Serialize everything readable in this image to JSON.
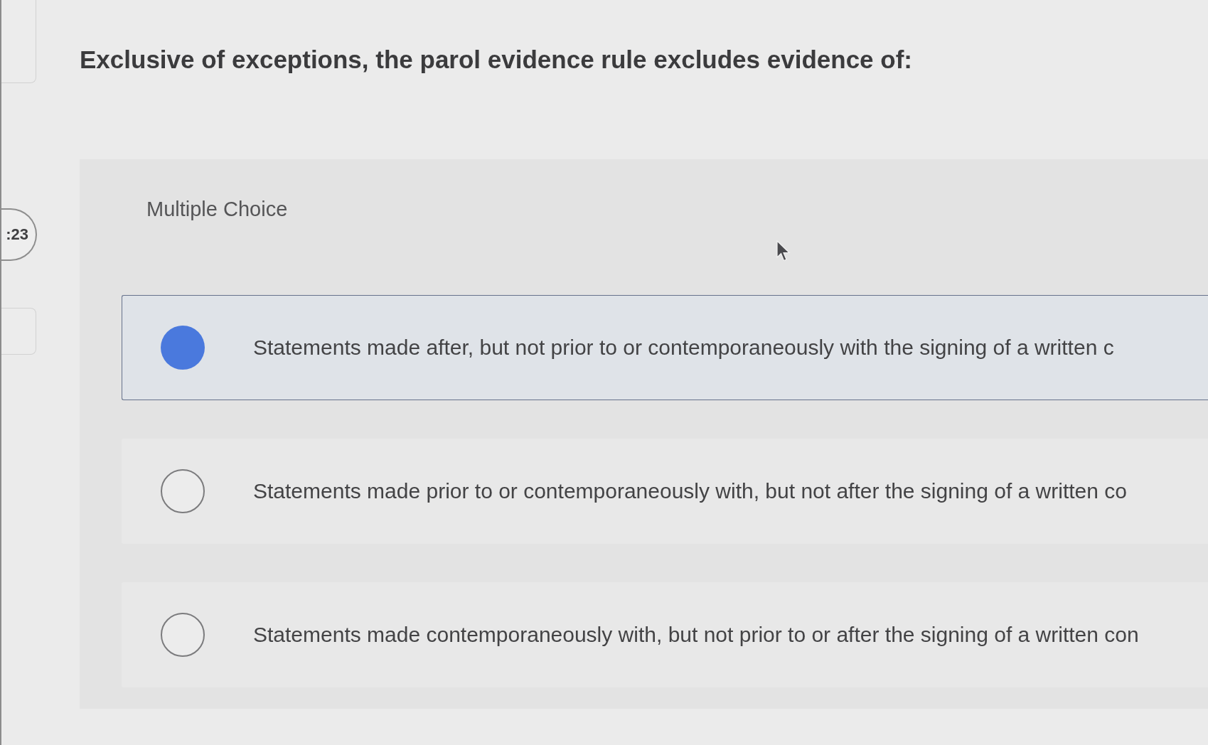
{
  "timer": {
    "text": ":23"
  },
  "question": {
    "text": "Exclusive of exceptions, the parol evidence rule excludes evidence of:"
  },
  "answer_panel": {
    "label": "Multiple Choice",
    "options": [
      {
        "text": "Statements made after, but not prior to or contemporaneously with the signing of a written c",
        "selected": true
      },
      {
        "text": "Statements made prior to or contemporaneously with, but not after the signing of a written co",
        "selected": false
      },
      {
        "text": "Statements made contemporaneously with, but not prior to or after the signing of a written con",
        "selected": false
      }
    ]
  }
}
